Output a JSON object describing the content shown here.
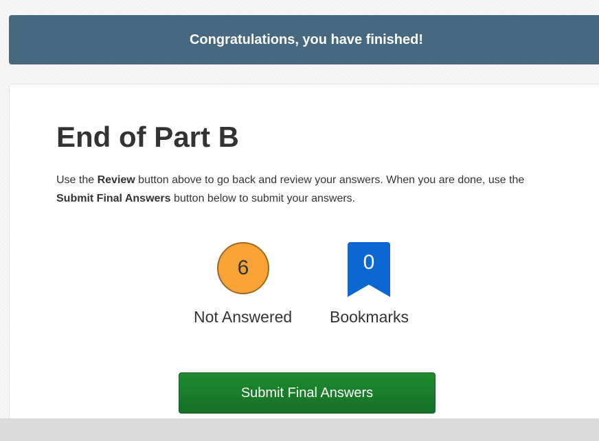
{
  "banner": {
    "message": "Congratulations, you have finished!"
  },
  "main": {
    "title": "End of Part B",
    "instructions": {
      "part1": "Use the ",
      "review_bold": "Review",
      "part2": " button above to go back and review your answers. When you are done, use the ",
      "submit_bold": "Submit Final Answers",
      "part3": " button below to submit your answers."
    }
  },
  "stats": {
    "not_answered": {
      "count": "6",
      "label": "Not Answered",
      "color": "#f7a335"
    },
    "bookmarks": {
      "count": "0",
      "label": "Bookmarks",
      "color": "#0d67d3",
      "icon": "bookmark-icon"
    }
  },
  "actions": {
    "submit_label": "Submit Final Answers",
    "submit_color": "#1a7e2b"
  },
  "colors": {
    "banner_background": "#47697f",
    "page_background": "#f3f3f3",
    "text": "#333333"
  }
}
